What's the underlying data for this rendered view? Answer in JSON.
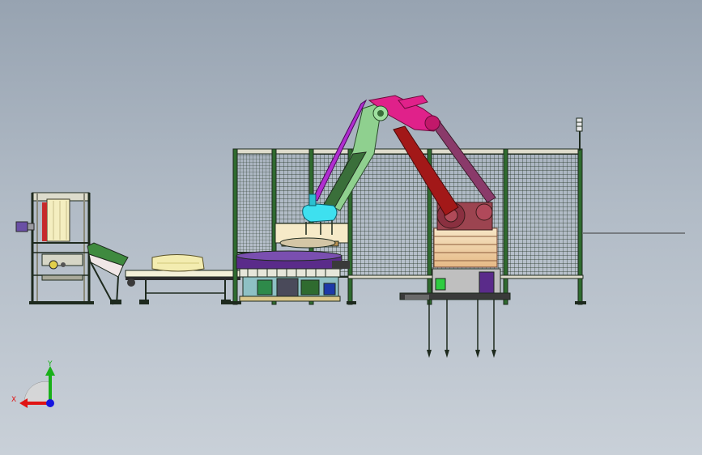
{
  "viewport": {
    "background_top": "#97a3b1",
    "background_bottom": "#c9d0d8"
  },
  "triad": {
    "x_label": "X",
    "y_label": "Y",
    "x_color": "#e01414",
    "y_color": "#19b019",
    "z_color": "#1515e0"
  },
  "colors": {
    "frame": "#1e2a1e",
    "fence_post": "#2f6b2f",
    "robot_upper_arm": "#c2186a",
    "robot_lower_arm": "#a21818",
    "robot_base": "#9c4450",
    "robot_wrist": "#3a6f3a",
    "gripper": "#3ee0ef",
    "rotary_table": "#5a2b8a",
    "conveyor_bag": "#f3ecb0",
    "infeed_chute": "#3f8a3f"
  },
  "parts": [
    "bag-infeed-stand",
    "inclined-conveyor",
    "flat-conveyor",
    "rotary-indexing-table",
    "palletizing-robot",
    "safety-fence",
    "signal-tower",
    "anchor-bolts"
  ]
}
